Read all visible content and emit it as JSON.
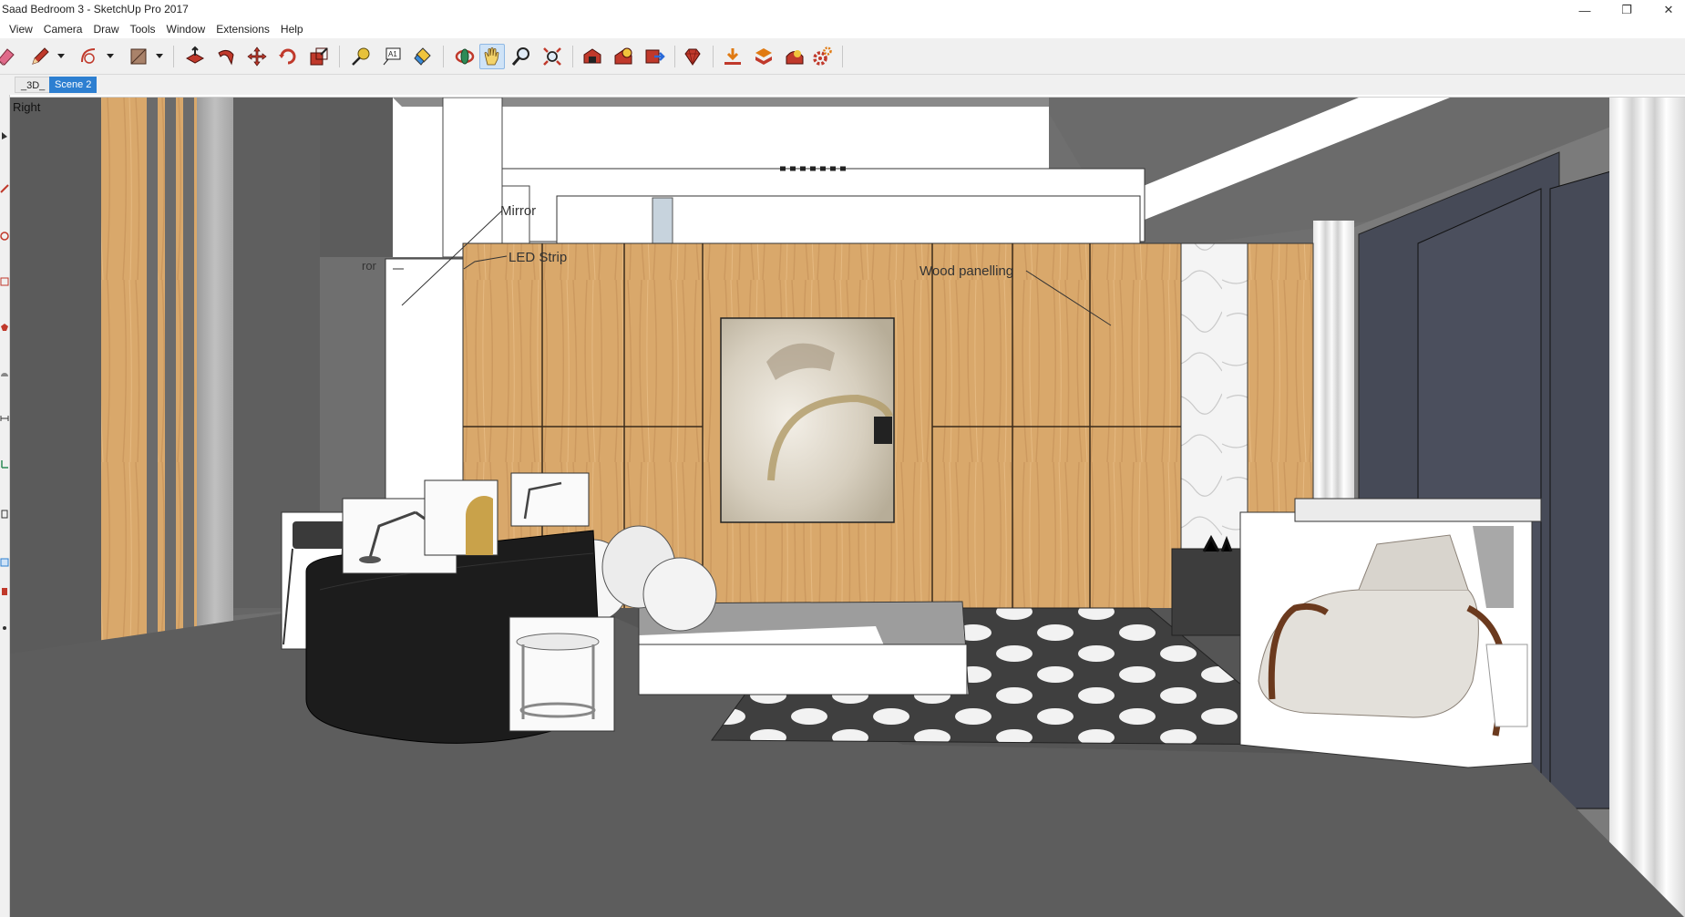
{
  "window": {
    "title": "Saad Bedroom 3 - SketchUp Pro 2017",
    "min_glyph": "—",
    "max_glyph": "❐",
    "close_glyph": "✕"
  },
  "menu": [
    "View",
    "Camera",
    "Draw",
    "Tools",
    "Window",
    "Extensions",
    "Help"
  ],
  "toolbar": {
    "icons": [
      "eraser-icon",
      "pencil-icon",
      "arc-icon",
      "rectangle-icon",
      "push-pull-icon",
      "follow-me-icon",
      "move-icon",
      "rotate-icon",
      "scale-icon",
      "tape-measure-icon",
      "text-icon",
      "paint-bucket-icon",
      "orbit-icon",
      "pan-icon",
      "zoom-icon",
      "zoom-extents-icon",
      "warehouse-icon",
      "share-model-icon",
      "extension-warehouse-icon",
      "ruby-console-icon",
      "download-icon",
      "layout-icon",
      "plugin-icon",
      "settings-gear-icon"
    ],
    "active_tool": "pan-icon"
  },
  "scene_tabs": [
    {
      "label": "_3D_",
      "active": false
    },
    {
      "label": "Scene 2",
      "active": true
    }
  ],
  "viewport": {
    "view_name": "Right",
    "annotations": {
      "mirror": "Mirror",
      "led_strip": "LED Strip",
      "wood_panelling": "Wood panelling",
      "ror": "ror"
    }
  },
  "colors": {
    "active_tab": "#2d7fd1",
    "wood": "#d8a56a",
    "ceiling": "#6b6b6b",
    "floor": "#5b5b5b",
    "window_glass": "#4a4e5b"
  }
}
